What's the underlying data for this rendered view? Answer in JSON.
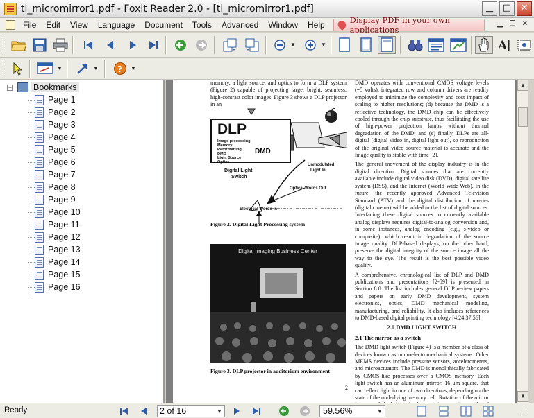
{
  "window": {
    "title": "ti_micromirror1.pdf - Foxit Reader 2.0 - [ti_micromirror1.pdf]"
  },
  "menu": {
    "items": [
      "File",
      "Edit",
      "View",
      "Language",
      "Document",
      "Tools",
      "Advanced",
      "Window",
      "Help"
    ],
    "promo": "Display PDF in your own applications"
  },
  "bookmarks": {
    "root": "Bookmarks",
    "pages": [
      "Page 1",
      "Page 2",
      "Page 3",
      "Page 4",
      "Page 5",
      "Page 6",
      "Page 7",
      "Page 8",
      "Page 9",
      "Page 10",
      "Page 11",
      "Page 12",
      "Page 13",
      "Page 14",
      "Page 15",
      "Page 16"
    ]
  },
  "document": {
    "left_top_text": "memory, a light source, and optics to form a DLP system (Figure 2) capable of projecting large, bright, seamless, high-contrast color images. Figure 3 shows a DLP projector in an",
    "diagram": {
      "title": "DLP",
      "components": [
        "Image processing",
        "Memory",
        "Reformatting",
        "DMD",
        "Light Source",
        "Optics"
      ],
      "dmd_label": "DMD",
      "switch_label_1": "Digital Light",
      "switch_label_2": "Switch",
      "unmodulated_1": "Unmodulated",
      "unmodulated_2": "Light In",
      "optical_out": "Optical Words Out",
      "electrical_in": "Electrical Words In"
    },
    "fig2_caption": "Figure 2. Digital Light Processing system",
    "photo_title": "Digital Imaging Business Center",
    "fig3_caption": "Figure 3. DLP projector in auditorium environment",
    "right_para1": "DMD operates with conventional CMOS voltage levels (~5 volts), integrated row and column drivers are readily employed to minimize the complexity and cost impact of scaling to higher resolutions; (d) because the DMD is a reflective technology, the DMD chip can be effectively cooled through the chip substrate, thus facilitating the use of high-power projection lamps without thermal degradation of the DMD; and (e) finally, DLPs are all-digital (digital video in, digital light out), so reproduction of the original video source material is accurate and the image quality is stable with time [2].",
    "right_para2": "The general movement of the display industry is in the digital direction. Digital sources that are currently available include digital video disk (DVD), digital satellite system (DSS), and the Internet (World Wide Web). In the future, the recently approved Advanced Television Standard (ATV) and the digital distribution of movies (digital cinema) will be added to the list of digital sources. Interfacing these digital sources to currently available analog displays requires digital-to-analog conversion and, in some instances, analog encoding (e.g., s-video or composite), which result in degradation of the source image quality. DLP-based displays, on the other hand, preserve the digital integrity of the source image all the way to the eye. The result is the best possible video quality.",
    "right_para3": "A comprehensive, chronological list of DLP and DMD publications and presentations [2-59] is presented in Section 8.0. The list includes general DLP review papers and papers on early DMD development, system electronics, optics, DMD mechanical modeling, manufacturing, and reliability. It also includes references to DMD-based digital printing technology [4,24,37,56].",
    "section_heading": "2.0  DMD LIGHT SWITCH",
    "subsection_heading": "2.1  The mirror as a switch",
    "right_para4": "The DMD light switch (Figure 4) is a member of a class of devices known as microelectromechanical systems. Other MEMS devices include pressure sensors, accelerometers, and microactuators. The DMD is monolithically fabricated by CMOS-like processes over a CMOS memory. Each light switch has an aluminum mirror, 16 μm square, that can reflect light in one of two directions, depending on the state of the underlying memory cell. Rotation of the mirror is accomplished through electrostatic attraction produced by",
    "page_number": "2"
  },
  "status": {
    "ready": "Ready",
    "page_indicator": "2 of 16",
    "zoom": "59.56%"
  }
}
